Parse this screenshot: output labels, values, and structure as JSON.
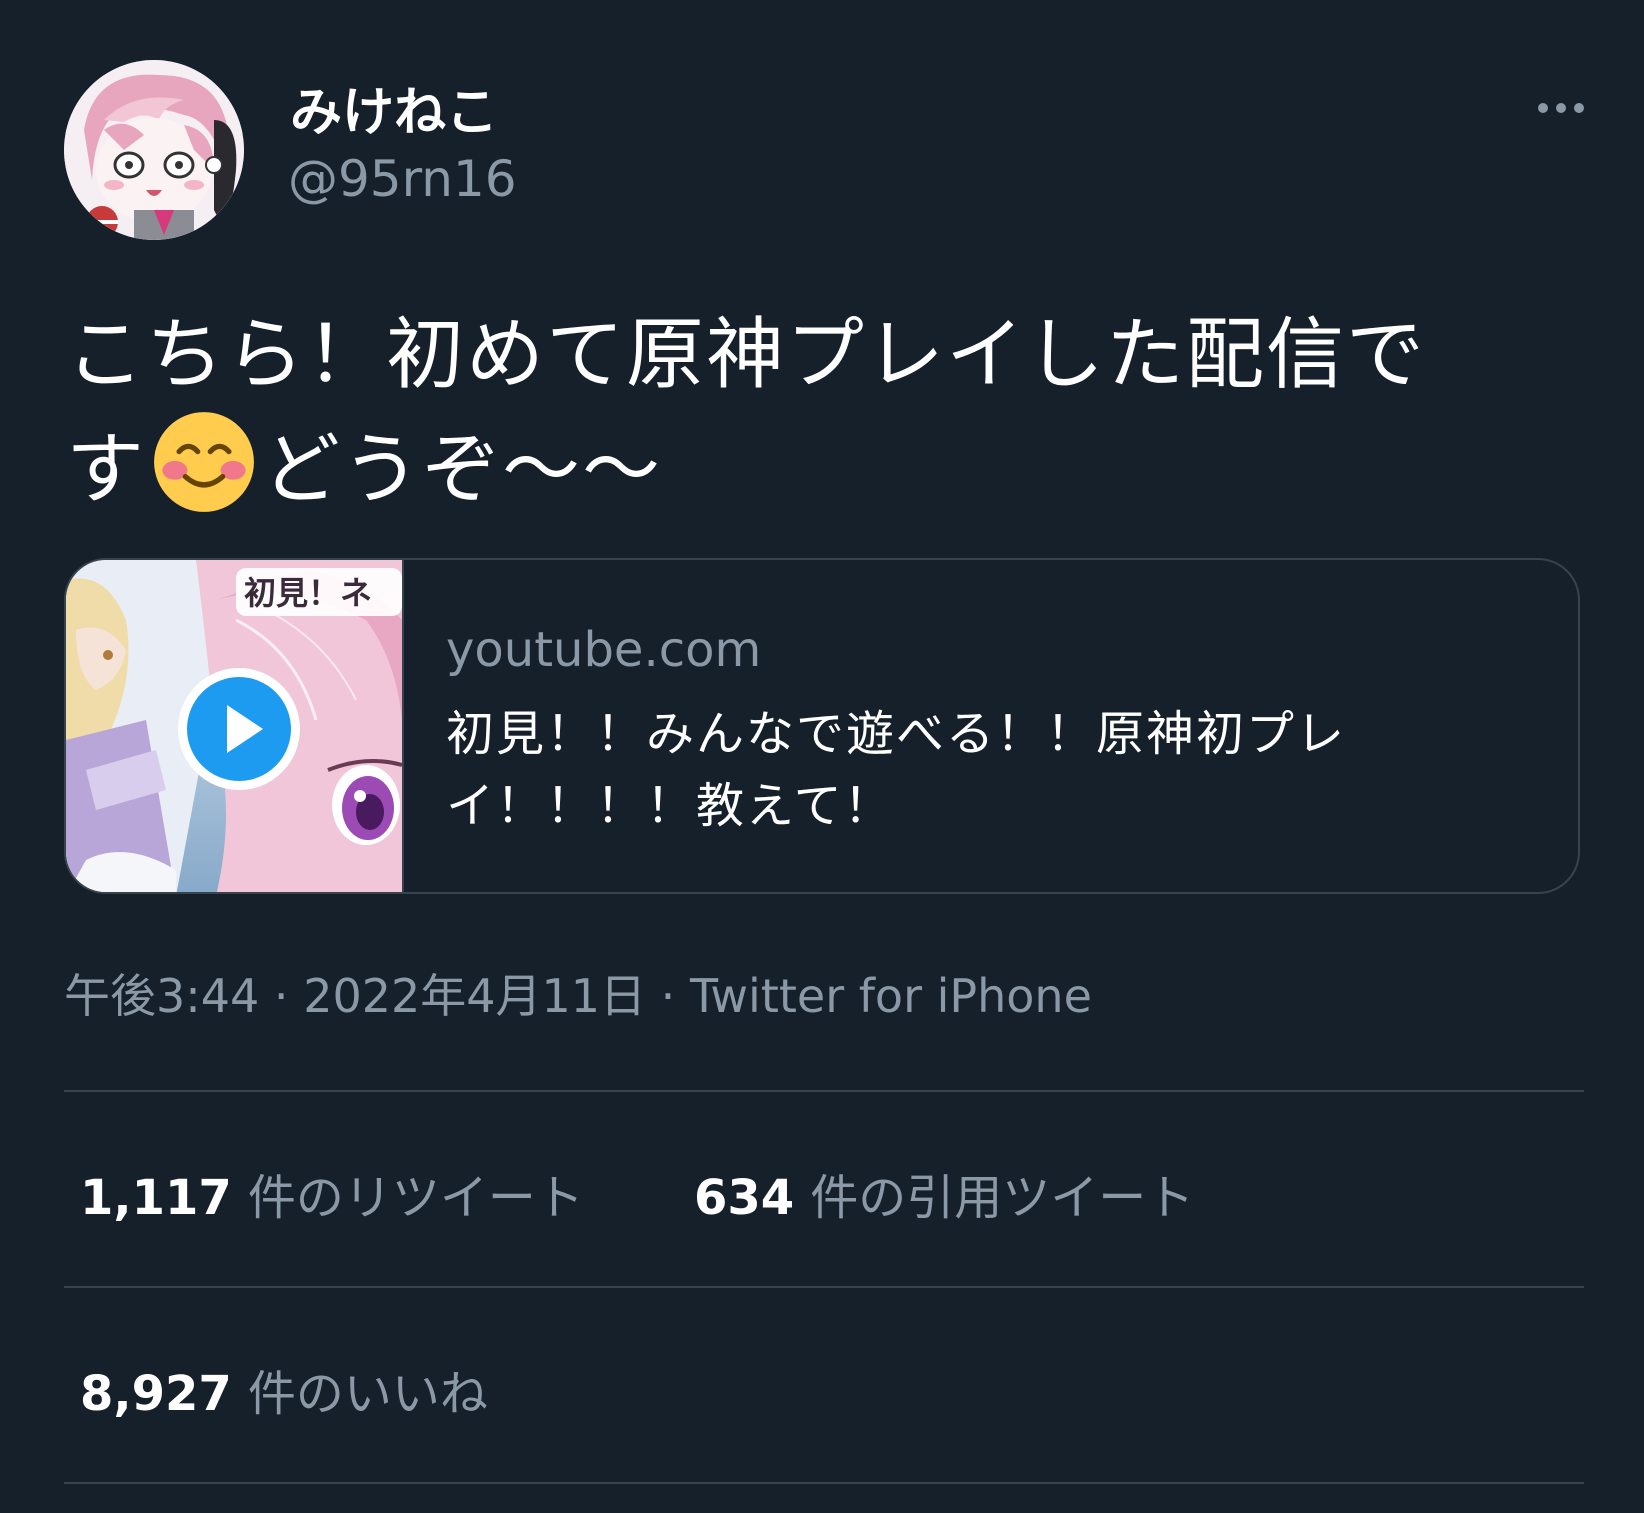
{
  "user": {
    "display_name": "みけねこ",
    "handle": "@95rn16",
    "avatar_icon": "avatar-image"
  },
  "tweet": {
    "text_part1": "こちら！初めて原神プレイした配信で",
    "text_part2_before_emoji": "す",
    "emoji": "smiling-face-with-blush-emoji",
    "text_part2_after_emoji": "どうぞ〜〜"
  },
  "card": {
    "domain": "youtube.com",
    "title": "初見！！みんなで遊べる！！原神初プレイ！！！！教えて！",
    "thumbnail_text": "初見！ネ",
    "play_icon": "play-icon"
  },
  "meta": {
    "time": "午後3:44",
    "date": "2022年4月11日",
    "source": "Twitter for iPhone",
    "separator": " · "
  },
  "stats": {
    "retweets_count": "1,117",
    "retweets_label": "件のリツイート",
    "quotes_count": "634",
    "quotes_label": "件の引用ツイート",
    "likes_count": "8,927",
    "likes_label": "件のいいね"
  },
  "colors": {
    "background": "#15202b",
    "secondary_text": "#8b98a5",
    "border": "#38444d",
    "accent": "#1d9bf0"
  }
}
